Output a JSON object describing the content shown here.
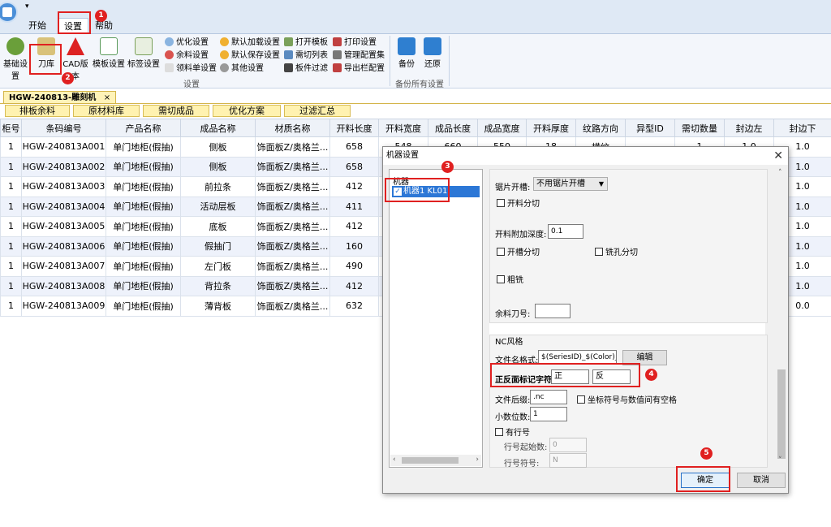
{
  "ribbon": {
    "quick_access": "▾",
    "tabs": [
      "开始",
      "设置",
      "帮助"
    ],
    "buttons": {
      "basic_settings": "基础设置",
      "tool_library": "刀库",
      "cad_version": "CAD版本",
      "template_settings": "模板设置",
      "label_settings": "标签设置",
      "optimize_settings": "优化设置",
      "surplus_settings": "余料设置",
      "material_list_settings": "领料单设置",
      "default_load_settings": "默认加载设置",
      "default_save_settings": "默认保存设置",
      "other_settings": "其他设置",
      "open_template": "打开模板",
      "cut_list": "需切列表",
      "board_filter": "板件过滤",
      "print_settings": "打印设置",
      "manage_config_set": "管理配置集",
      "export_column_config": "导出栏配置",
      "backup": "备份",
      "restore": "还原"
    },
    "groups": {
      "settings": "设置",
      "backup_all": "备份所有设置"
    }
  },
  "doc_tab": {
    "label": "HGW-240813-雕刻机",
    "close": "×"
  },
  "sub_tabs": [
    "排板余料",
    "原材料库",
    "需切成品",
    "优化方案",
    "过滤汇总"
  ],
  "grid": {
    "headers": [
      "柜号",
      "条码编号",
      "产品名称",
      "成品名称",
      "材质名称",
      "开料长度",
      "开料宽度",
      "成品长度",
      "成品宽度",
      "开料厚度",
      "纹路方向",
      "异型ID",
      "需切数量",
      "封边左",
      "封边下"
    ],
    "rows": [
      [
        "1",
        "HGW-240813A001",
        "单门地柜(假抽)",
        "侧板",
        "饰面板Z/奥格兰...",
        "658",
        "548",
        "660",
        "550",
        "18",
        "横纹",
        "",
        "1",
        "1.0",
        "1.0"
      ],
      [
        "1",
        "HGW-240813A002",
        "单门地柜(假抽)",
        "侧板",
        "饰面板Z/奥格兰...",
        "658",
        "",
        "",
        "",
        "",
        "",
        "",
        "",
        "",
        "1.0"
      ],
      [
        "1",
        "HGW-240813A003",
        "单门地柜(假抽)",
        "前拉条",
        "饰面板Z/奥格兰...",
        "412",
        "",
        "",
        "",
        "",
        "",
        "",
        "",
        "",
        "1.0"
      ],
      [
        "1",
        "HGW-240813A004",
        "单门地柜(假抽)",
        "活动层板",
        "饰面板Z/奥格兰...",
        "411",
        "",
        "",
        "",
        "",
        "",
        "",
        "",
        "",
        "1.0"
      ],
      [
        "1",
        "HGW-240813A005",
        "单门地柜(假抽)",
        "底板",
        "饰面板Z/奥格兰...",
        "412",
        "",
        "",
        "",
        "",
        "",
        "",
        "",
        "",
        "1.0"
      ],
      [
        "1",
        "HGW-240813A006",
        "单门地柜(假抽)",
        "假抽门",
        "饰面板Z/奥格兰...",
        "160",
        "",
        "",
        "",
        "",
        "",
        "",
        "",
        "",
        "1.0"
      ],
      [
        "1",
        "HGW-240813A007",
        "单门地柜(假抽)",
        "左门板",
        "饰面板Z/奥格兰...",
        "490",
        "",
        "",
        "",
        "",
        "",
        "",
        "",
        "",
        "1.0"
      ],
      [
        "1",
        "HGW-240813A008",
        "单门地柜(假抽)",
        "背拉条",
        "饰面板Z/奥格兰...",
        "412",
        "",
        "",
        "",
        "",
        "",
        "",
        "",
        "",
        "1.0"
      ],
      [
        "1",
        "HGW-240813A009",
        "单门地柜(假抽)",
        "薄背板",
        "饰面板Z/奥格兰...",
        "632",
        "",
        "",
        "",
        "",
        "",
        "",
        "",
        "",
        "0.0"
      ]
    ]
  },
  "dialog": {
    "title": "机器设置",
    "close": "✕",
    "tree_root": "机器",
    "tree_item": "机器1 KL01",
    "tree_check": "✓",
    "scroll_left": "‹",
    "scroll_right": "›",
    "scroll_up": "˄",
    "scroll_down": "˅",
    "saw_slot_label": "锯片开槽:",
    "saw_slot_value": "不用锯片开槽",
    "cut_split": "开料分切",
    "extra_depth_label": "开料附加深度:",
    "extra_depth_value": "0.1",
    "slot_split": "开槽分切",
    "mill_hole_split": "铣孔分切",
    "rough_mill": "粗铣",
    "surplus_tool_label": "余料刀号:",
    "surplus_tool_value": "",
    "nc_style_label": "NC风格",
    "filename_format_label": "文件名格式:",
    "filename_format_value": "$(SeriesID)_$(Color)_$(I",
    "edit_button": "编辑",
    "side_mark_label": "正反面标记字符:",
    "side_mark_front": "正",
    "side_mark_back": "反",
    "file_suffix_label": "文件后缀:",
    "file_suffix_value": ".nc",
    "space_option": "坐标符号与数值间有空格",
    "decimal_label": "小数位数:",
    "decimal_value": "1",
    "line_number": "有行号",
    "line_start_label": "行号起始数:",
    "line_start_value": "0",
    "line_symbol_label": "行号符号:",
    "line_symbol_value": "N",
    "ok_button": "确定",
    "cancel_button": "取消"
  },
  "annotations": [
    "1",
    "2",
    "3",
    "4",
    "5"
  ]
}
